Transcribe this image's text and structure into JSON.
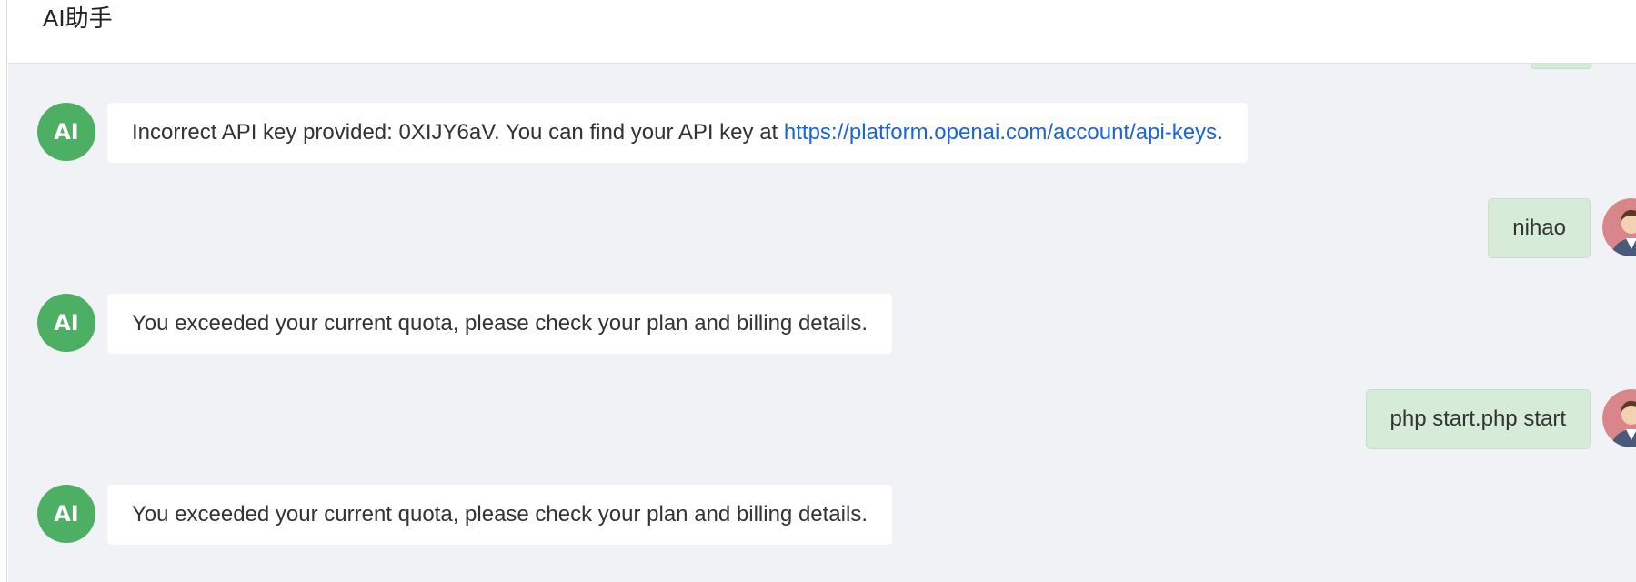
{
  "header": {
    "title": "AI助手"
  },
  "messages": [
    {
      "role": "ai",
      "avatar": "AI",
      "text_before": "Incorrect API key provided: 0XIJY6aV. You can find your API key at ",
      "link_text": "https://platform.openai.com/account/api-keys",
      "text_after": "."
    },
    {
      "role": "user",
      "avatar": "user-avatar-icon",
      "text": "nihao"
    },
    {
      "role": "ai",
      "avatar": "AI",
      "text": "You exceeded your current quota, please check your plan and billing details."
    },
    {
      "role": "user",
      "avatar": "user-avatar-icon",
      "text": "php start.php start"
    },
    {
      "role": "ai",
      "avatar": "AI",
      "text": "You exceeded your current quota, please check your plan and billing details."
    }
  ],
  "colors": {
    "ai_avatar": "#4caf63",
    "user_bubble": "#d6ebd8",
    "ai_bubble": "#ffffff",
    "chat_background": "#f0f2f5",
    "link": "#1a66d8"
  }
}
